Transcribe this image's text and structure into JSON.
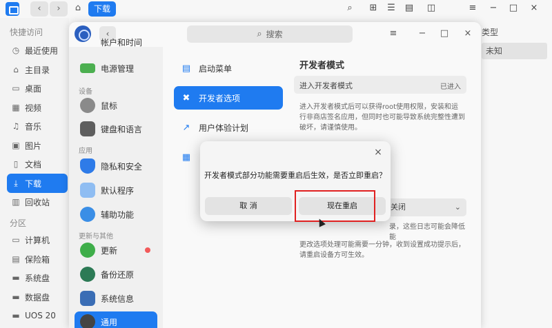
{
  "file_manager": {
    "breadcrumb": "下载",
    "sidebar": {
      "quick_access_title": "快捷访问",
      "quick_items": [
        "最近使用",
        "主目录",
        "桌面",
        "视频",
        "音乐",
        "图片",
        "文档",
        "下载",
        "回收站"
      ],
      "partition_title": "分区",
      "partition_items": [
        "计算机",
        "保险箱",
        "系统盘",
        "数据盘",
        "UOS 20"
      ]
    },
    "column_header": "类型",
    "row_value": "未知"
  },
  "control_center": {
    "search_placeholder": "搜索",
    "top_partial_item": "帐户和时间",
    "sidebar": {
      "power_item": "电源管理",
      "category_device": "设备",
      "mouse_item": "鼠标",
      "keyboard_item": "键盘和语言",
      "category_apps": "应用",
      "privacy_item": "隐私和安全",
      "default_apps_item": "默认程序",
      "accessibility_item": "辅助功能",
      "category_update": "更新与其他",
      "update_item": "更新",
      "backup_item": "备份还原",
      "sysinfo_item": "系统信息",
      "general_item": "通用"
    },
    "mid": {
      "boot_menu": "启动菜单",
      "developer_options": "开发者选项",
      "ux_program": "用户体验计划"
    },
    "content": {
      "heading": "开发者模式",
      "row_label": "进入开发者模式",
      "row_status": "已进入",
      "description": "进入开发者模式后可以获得root使用权限，安装和运行非商店签名应用，但同时也可能导致系统完整性遭到破坏，请谨慎使用。",
      "select_value": "关闭",
      "frag_log": "录，这些日志可能会降低",
      "frag_pe": "能",
      "description2": "更改选项处理可能需要一分钟，收到设置成功提示后，请重启设备方可生效。"
    }
  },
  "dialog": {
    "message": "开发者模式部分功能需要重启后生效，是否立即重启？",
    "cancel_label": "取 消",
    "confirm_label": "现在重启"
  },
  "colors": {
    "accent": "#1f7bf0",
    "highlight_box": "#e02020",
    "badge": "#f25a5a"
  }
}
